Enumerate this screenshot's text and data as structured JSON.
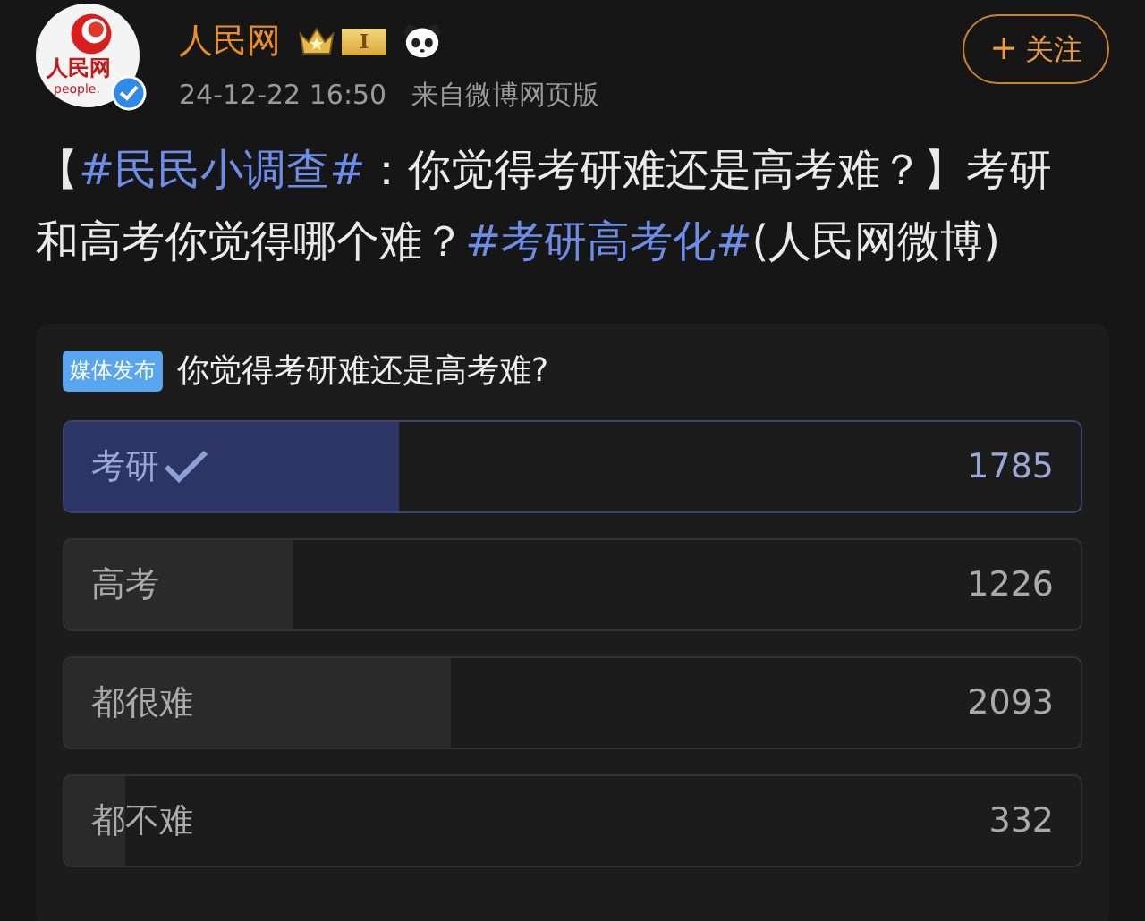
{
  "author": {
    "name": "人民网",
    "avatar_text": [
      "人民网",
      "people."
    ],
    "level_badge": "I",
    "time": "24-12-22 16:50",
    "source": "来自微博网页版"
  },
  "follow_button": {
    "icon": "+",
    "label": "关注"
  },
  "post": [
    {
      "kind": "text",
      "text": "【"
    },
    {
      "kind": "hashtag",
      "text": "#民民小调查#"
    },
    {
      "kind": "text",
      "text": "：你觉得考研难还是高考难？】考研和高考你觉得哪个难？"
    },
    {
      "kind": "hashtag",
      "text": "#考研高考化#"
    },
    {
      "kind": "text",
      "text": "(人民网微博)"
    }
  ],
  "poll": {
    "tag": "媒体发布",
    "question": "你觉得考研难还是高考难?",
    "options": [
      {
        "label": "考研",
        "count": "1785",
        "level": 0.33,
        "selected": true
      },
      {
        "label": "高考",
        "count": "1226",
        "level": 0.225,
        "selected": false
      },
      {
        "label": "都很难",
        "count": "2093",
        "level": 0.38,
        "selected": false
      },
      {
        "label": "都不难",
        "count": "332",
        "level": 0.06,
        "selected": false
      }
    ]
  }
}
